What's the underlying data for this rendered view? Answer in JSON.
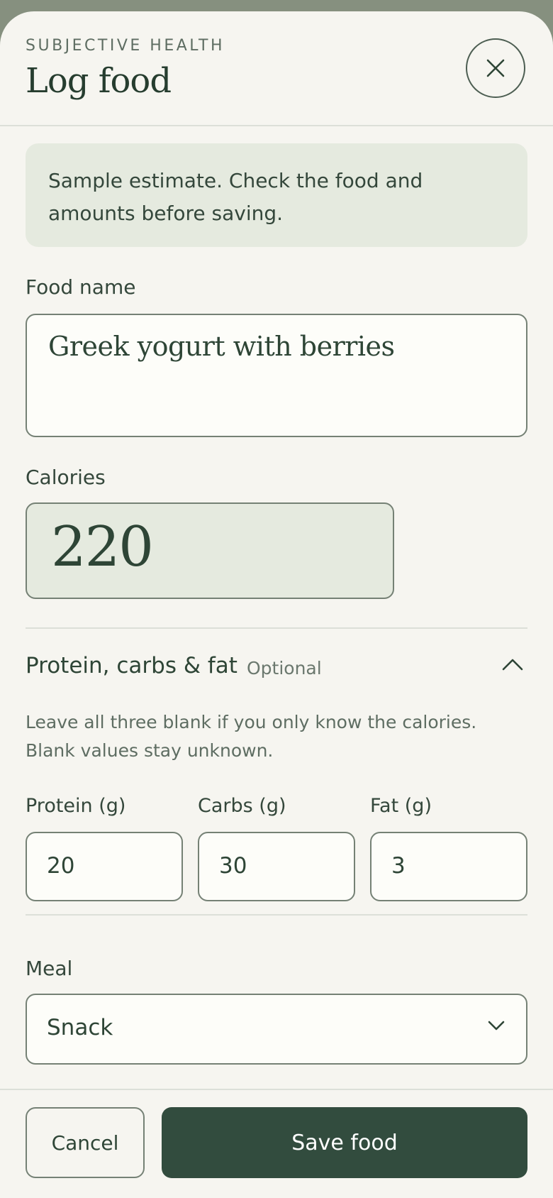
{
  "header": {
    "eyebrow": "SUBJECTIVE HEALTH",
    "title": "Log food"
  },
  "notice": {
    "text": "Sample estimate. Check the food and amounts before saving."
  },
  "food": {
    "label": "Food name",
    "value": "Greek yogurt with berries"
  },
  "calories": {
    "label": "Calories",
    "value": "220"
  },
  "macros": {
    "title": "Protein, carbs & fat",
    "optional": "Optional",
    "hint": "Leave all three blank if you only know the calories. Blank values stay unknown.",
    "protein": {
      "label": "Protein (g)",
      "value": "20"
    },
    "carbs": {
      "label": "Carbs (g)",
      "value": "30"
    },
    "fat": {
      "label": "Fat (g)",
      "value": "3"
    }
  },
  "meal": {
    "label": "Meal",
    "value": "Snack"
  },
  "actions": {
    "cancel": "Cancel",
    "save": "Save food"
  },
  "colors": {
    "primary": "#324c3e",
    "accent_fill": "#e5eadf",
    "backdrop": "#86907f"
  },
  "icons": {
    "close": "close-icon",
    "collapse": "chevron-up-icon",
    "dropdown": "chevron-down-icon"
  }
}
